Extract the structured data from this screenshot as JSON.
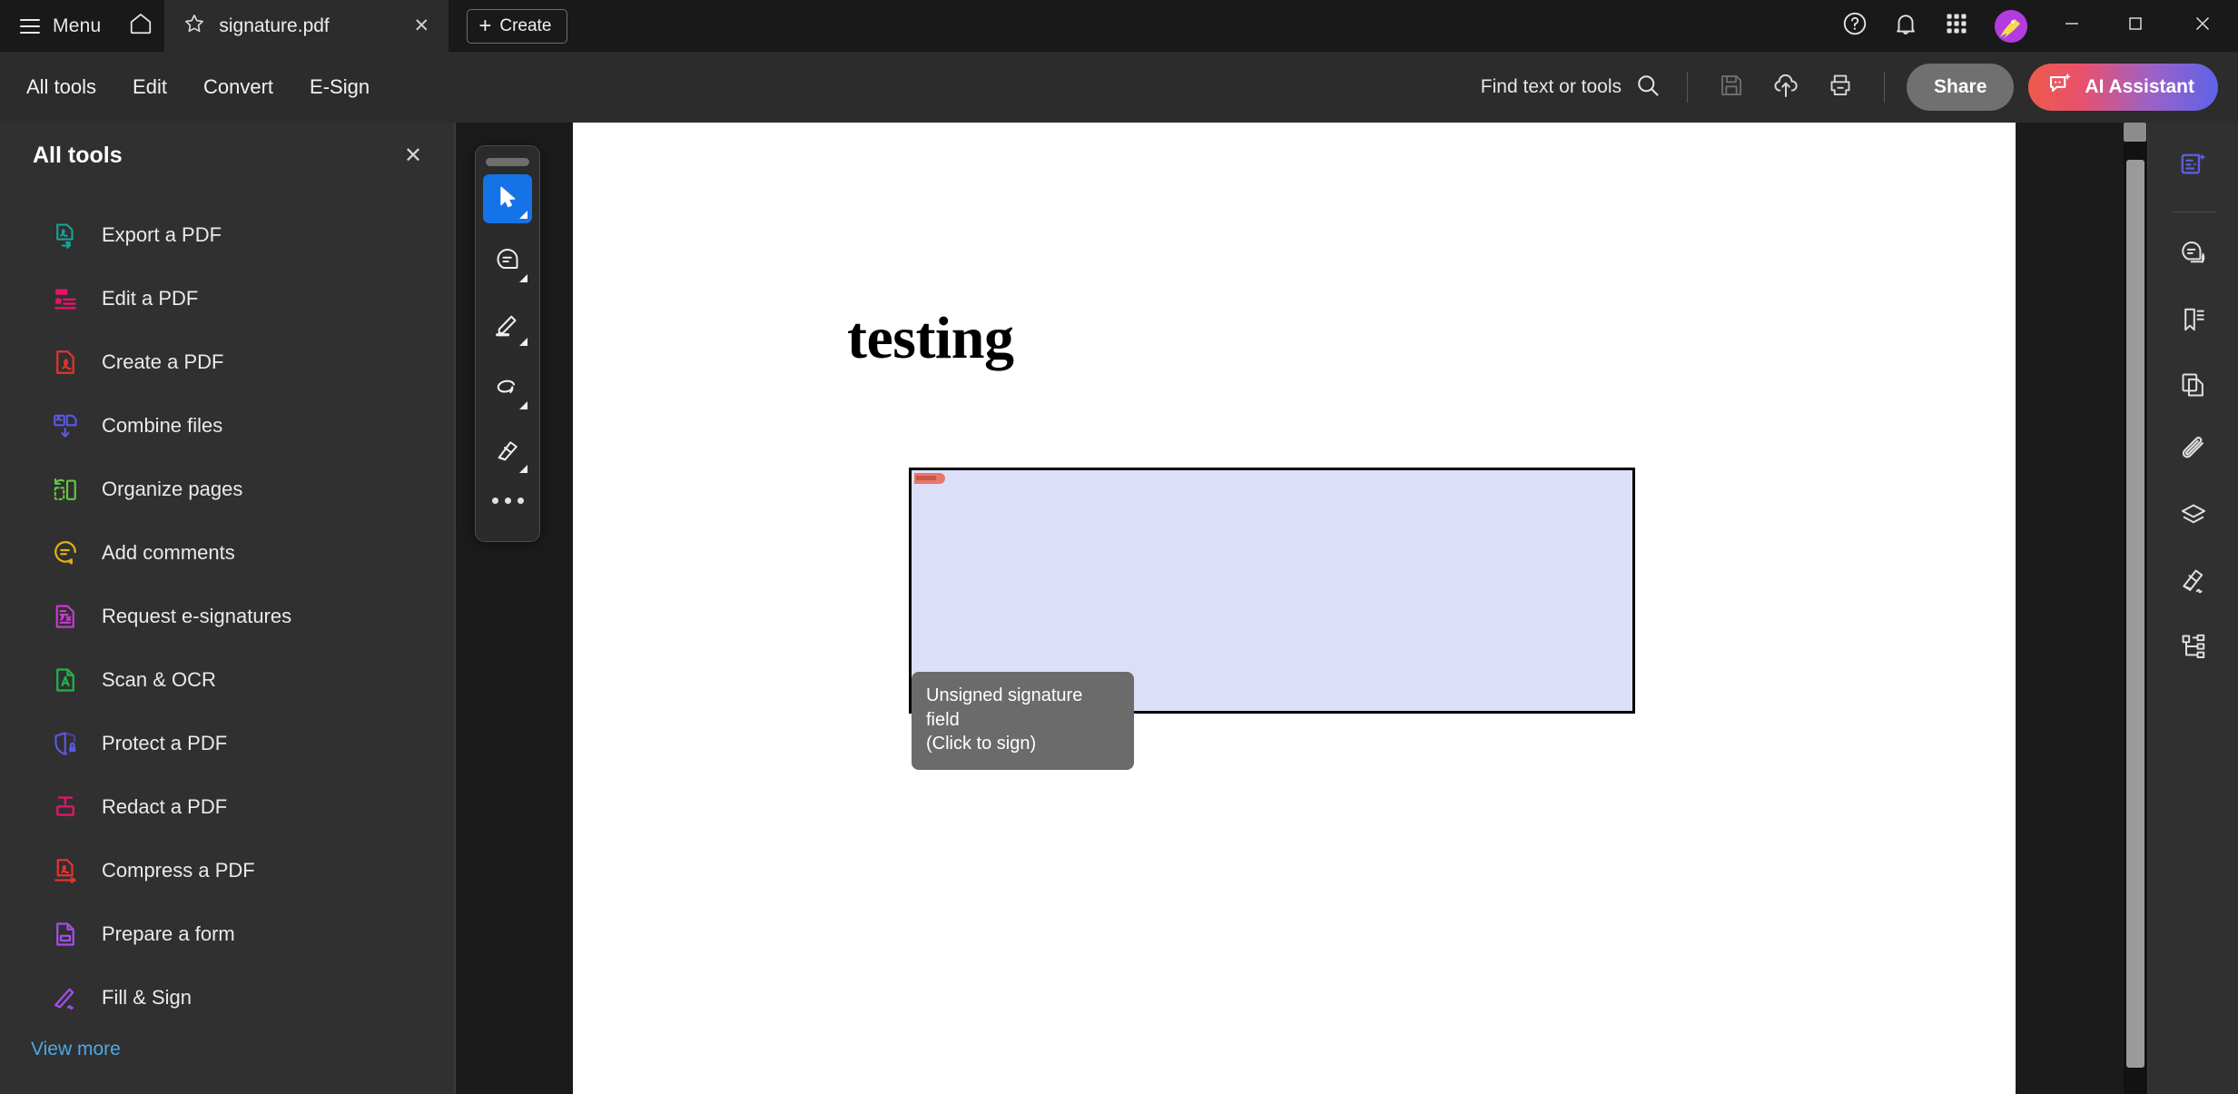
{
  "titlebar": {
    "menu_label": "Menu",
    "menu_icon": "hamburger-icon",
    "home_icon": "home-icon",
    "tab": {
      "star_icon": "star-icon",
      "title": "signature.pdf",
      "close_icon": "close-icon",
      "close_label": "✕"
    },
    "create_label": "Create",
    "create_plus": "+",
    "icons": [
      {
        "name": "help-icon"
      },
      {
        "name": "notifications-bell-icon"
      },
      {
        "name": "app-grid-icon"
      }
    ],
    "avatar_name": "user-avatar",
    "window_controls": {
      "minimize": "minimize-icon",
      "maximize": "maximize-icon",
      "close": "close-window-icon"
    }
  },
  "toolbar": {
    "tabs": [
      {
        "label": "All tools",
        "active": true
      },
      {
        "label": "Edit",
        "active": false
      },
      {
        "label": "Convert",
        "active": false
      },
      {
        "label": "E-Sign",
        "active": false
      }
    ],
    "find_label": "Find text or tools",
    "find_icon": "search-icon",
    "save_icon": "save-icon",
    "upload_icon": "cloud-upload-icon",
    "print_icon": "print-icon",
    "share_label": "Share",
    "ai_label": "AI Assistant",
    "ai_icon": "ai-sparkle-icon"
  },
  "left_panel": {
    "title": "All tools",
    "close_label": "✕",
    "view_more_label": "View more",
    "items": [
      {
        "label": "Export a PDF",
        "icon": "export-pdf-icon",
        "color": "#16a39a"
      },
      {
        "label": "Edit a PDF",
        "icon": "edit-pdf-icon",
        "color": "#e8136b"
      },
      {
        "label": "Create a PDF",
        "icon": "create-pdf-icon",
        "color": "#e3342f"
      },
      {
        "label": "Combine files",
        "icon": "combine-files-icon",
        "color": "#5b58e8"
      },
      {
        "label": "Organize pages",
        "icon": "organize-pages-icon",
        "color": "#63c943"
      },
      {
        "label": "Add comments",
        "icon": "add-comments-icon",
        "color": "#e0b016"
      },
      {
        "label": "Request e-signatures",
        "icon": "request-esign-icon",
        "color": "#cc3ad6"
      },
      {
        "label": "Scan & OCR",
        "icon": "scan-ocr-icon",
        "color": "#22b24c"
      },
      {
        "label": "Protect a PDF",
        "icon": "protect-pdf-icon",
        "color": "#5b58e8"
      },
      {
        "label": "Redact a PDF",
        "icon": "redact-pdf-icon",
        "color": "#e0156b"
      },
      {
        "label": "Compress a PDF",
        "icon": "compress-pdf-icon",
        "color": "#e3342f"
      },
      {
        "label": "Prepare a form",
        "icon": "prepare-form-icon",
        "color": "#a24ee8"
      },
      {
        "label": "Fill & Sign",
        "icon": "fill-sign-icon",
        "color": "#a24ee8"
      }
    ]
  },
  "document": {
    "heading": "testing",
    "signature_field": {
      "name": "unsigned-signature-field",
      "fill_color": "#dbe0f8",
      "border_color": "#000000",
      "flag_color": "#e8766a"
    },
    "tooltip_line1": "Unsigned signature field",
    "tooltip_line2": "(Click to sign)"
  },
  "float_toolbar": {
    "buttons": [
      {
        "name": "select-tool",
        "selected": true
      },
      {
        "name": "comment-tool",
        "selected": false
      },
      {
        "name": "highlight-tool",
        "selected": false
      },
      {
        "name": "draw-tool",
        "selected": false
      },
      {
        "name": "sign-tool",
        "selected": false
      }
    ],
    "more_label": "more-tools-icon"
  },
  "right_rail": {
    "buttons": [
      {
        "name": "ai-assistant-panel-icon",
        "accent": true
      },
      {
        "name": "comments-panel-icon",
        "accent": false
      },
      {
        "name": "bookmarks-panel-icon",
        "accent": false
      },
      {
        "name": "page-thumbnails-icon",
        "accent": false
      },
      {
        "name": "attachments-icon",
        "accent": false
      },
      {
        "name": "layers-icon",
        "accent": false
      },
      {
        "name": "sign-panel-icon",
        "accent": false
      },
      {
        "name": "tags-structure-icon",
        "accent": false
      }
    ]
  },
  "scrollbar": {
    "name": "vertical-scrollbar"
  }
}
